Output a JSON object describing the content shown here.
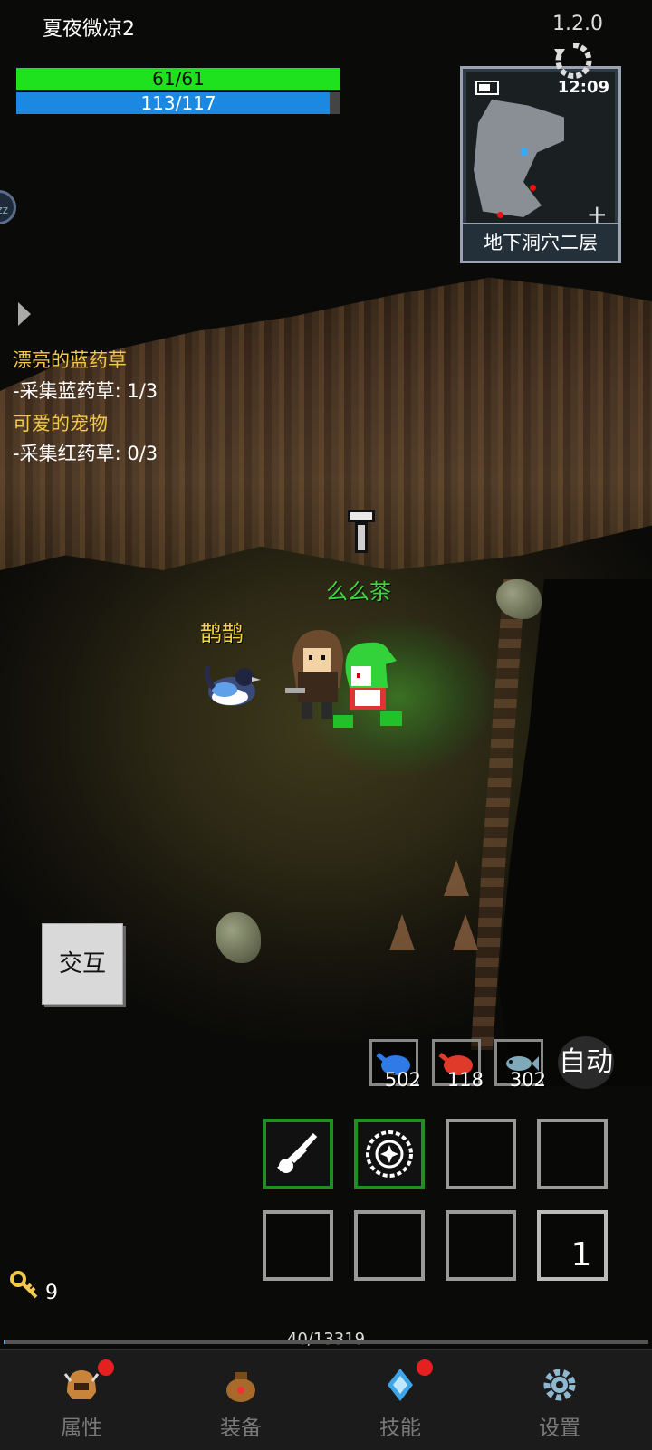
{
  "hud": {
    "player_name": "夏夜微凉2",
    "version": "1.2.0",
    "hp_text": "61/61",
    "hp_fraction": 1.0,
    "mp_text": "113/117",
    "mp_fraction": 0.966,
    "hp_color": "#1ee21e",
    "mp_color": "#1b88e2"
  },
  "minimap": {
    "time": "12:09",
    "area_name": "地下洞穴二层",
    "zoom_icon": "plus-icon"
  },
  "quests": [
    {
      "title": "漂亮的蓝药草",
      "task": "-采集蓝药草: 1/3"
    },
    {
      "title": "可爱的宠物",
      "task": "-采集红药草: 0/3"
    }
  ],
  "scene": {
    "npc_label": "么么茶",
    "pet_label": "鹊鹊"
  },
  "buttons": {
    "interact": "交互",
    "auto": "自动"
  },
  "potions": [
    {
      "icon": "blue-potion-icon",
      "count": "502"
    },
    {
      "icon": "red-potion-icon",
      "count": "118"
    },
    {
      "icon": "fish-icon",
      "count": "302"
    }
  ],
  "skill_page": "1",
  "keys": {
    "count": "9"
  },
  "xp": {
    "text": "40/13319",
    "fraction": 0.003
  },
  "nav": [
    {
      "label": "属性",
      "icon": "helmet-icon",
      "badge": true
    },
    {
      "label": "装备",
      "icon": "bag-icon",
      "badge": false
    },
    {
      "label": "技能",
      "icon": "crystal-icon",
      "badge": true
    },
    {
      "label": "设置",
      "icon": "gear-icon",
      "badge": false
    }
  ]
}
